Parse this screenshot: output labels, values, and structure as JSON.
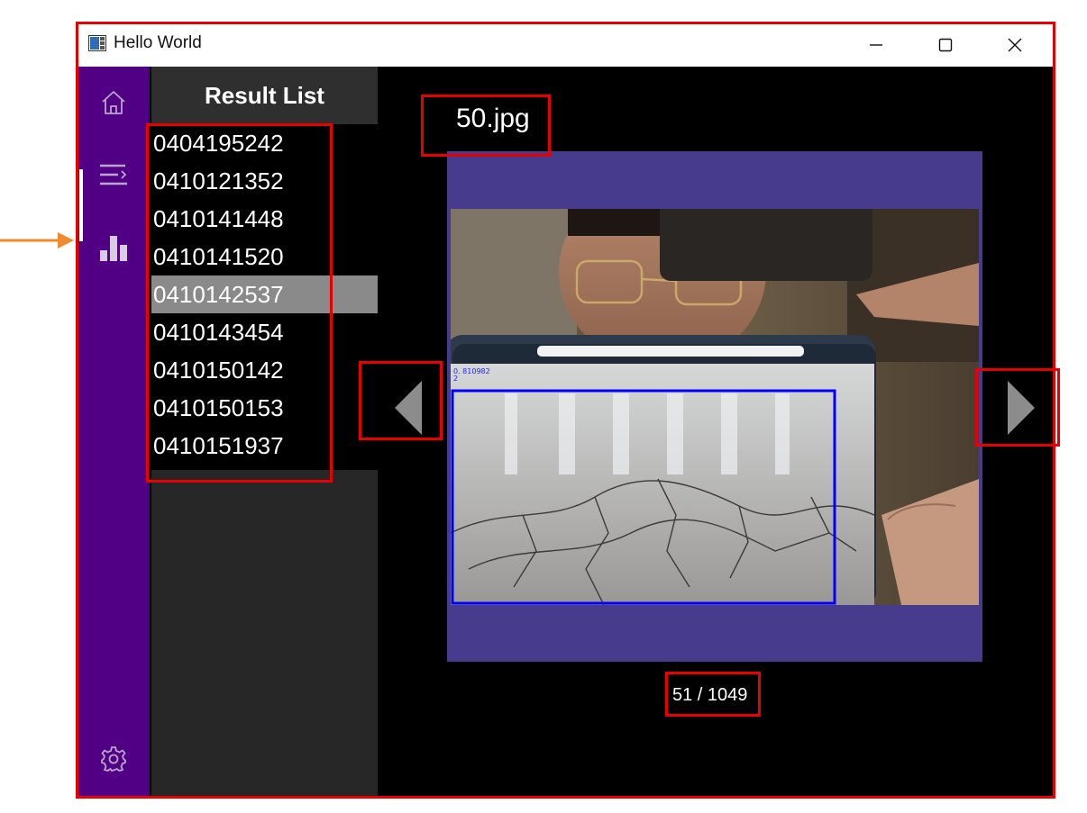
{
  "window": {
    "title": "Hello World",
    "controls": {
      "minimize": "—",
      "maximize": "□",
      "close": "✕"
    }
  },
  "nav": {
    "items": [
      {
        "icon": "home-icon",
        "selected": false
      },
      {
        "icon": "list-icon",
        "selected": false
      },
      {
        "icon": "bar-chart-icon",
        "selected": true
      }
    ],
    "footer_icon": "settings-gear-icon"
  },
  "result_list": {
    "header": "Result List",
    "items": [
      {
        "label": "0404195242",
        "selected": false
      },
      {
        "label": "0410121352",
        "selected": false
      },
      {
        "label": "0410141448",
        "selected": false
      },
      {
        "label": "0410141520",
        "selected": false
      },
      {
        "label": "0410142537",
        "selected": true
      },
      {
        "label": "0410143454",
        "selected": false
      },
      {
        "label": "0410150142",
        "selected": false
      },
      {
        "label": "0410150153",
        "selected": false
      },
      {
        "label": "0410151937",
        "selected": false
      }
    ]
  },
  "viewer": {
    "filename": "50.jpg",
    "counter": "51 / 1049",
    "detection_label": "0. 810982",
    "detection_label_line2": "2",
    "previous_icon": "triangle-left-icon",
    "next_icon": "triangle-right-icon"
  },
  "colors": {
    "nav_background": "#510086",
    "list_background": "#272727",
    "selected_item": "#8a8a8a",
    "image_frame": "#463b8d",
    "detection_box": "#0000ff",
    "annotation_box": "#e60000",
    "annotation_arrow": "#f08a2c"
  }
}
